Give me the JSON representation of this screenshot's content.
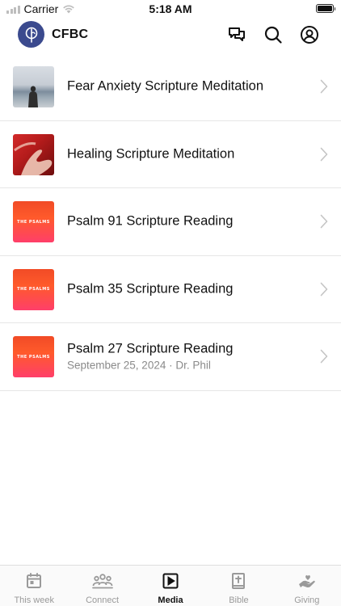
{
  "status_bar": {
    "carrier": "Carrier",
    "time": "5:18 AM"
  },
  "header": {
    "title": "CFBC",
    "icons": [
      "chat-bubbles-icon",
      "search-icon",
      "account-icon"
    ]
  },
  "media_items": [
    {
      "title": "Fear Anxiety Scripture Meditation",
      "subtitle": "",
      "thumb": "sea-photo"
    },
    {
      "title": "Healing Scripture Meditation",
      "subtitle": "",
      "thumb": "hands-photo"
    },
    {
      "title": "Psalm 91 Scripture Reading",
      "subtitle": "",
      "thumb": "the-psalms",
      "thumb_label": "THE PSALMS"
    },
    {
      "title": "Psalm 35 Scripture Reading",
      "subtitle": "",
      "thumb": "the-psalms",
      "thumb_label": "THE PSALMS"
    },
    {
      "title": "Psalm 27 Scripture Reading",
      "subtitle": "September 25, 2024 · Dr. Phil",
      "thumb": "the-psalms",
      "thumb_label": "THE PSALMS"
    }
  ],
  "tab_bar": {
    "tabs": [
      {
        "label": "This week",
        "icon": "calendar-icon",
        "active": false
      },
      {
        "label": "Connect",
        "icon": "people-icon",
        "active": false
      },
      {
        "label": "Media",
        "icon": "play-icon",
        "active": true
      },
      {
        "label": "Bible",
        "icon": "bible-icon",
        "active": false
      },
      {
        "label": "Giving",
        "icon": "giving-hand-icon",
        "active": false
      }
    ]
  },
  "colors": {
    "logo_bg": "#3b4a8e",
    "active_tab": "#111111",
    "inactive_tab": "#9a9a9a",
    "divider": "#e6e6e6"
  }
}
